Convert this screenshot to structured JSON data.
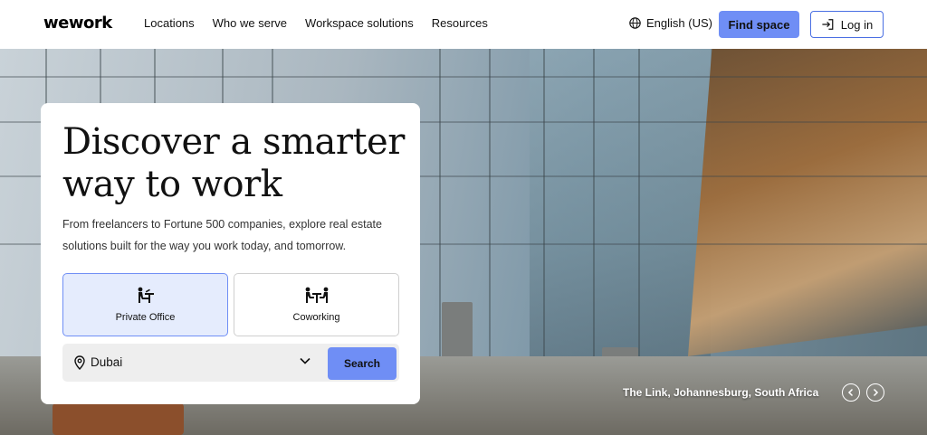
{
  "brand": {
    "logo": "wework"
  },
  "nav": {
    "items": [
      {
        "label": "Locations"
      },
      {
        "label": "Who we serve"
      },
      {
        "label": "Workspace solutions"
      },
      {
        "label": "Resources"
      }
    ],
    "language": "English (US)",
    "find_space": "Find space",
    "login": "Log in"
  },
  "hero": {
    "headline": "Discover a smarter way to work",
    "subtext": "From freelancers to Fortune 500 companies, explore real estate solutions built for the way you work today, and tomorrow.",
    "options": [
      {
        "label": "Private Office",
        "icon": "desk-person-icon",
        "selected": true
      },
      {
        "label": "Coworking",
        "icon": "coworking-icon",
        "selected": false
      }
    ],
    "location": {
      "value": "Dubai",
      "icon": "location-pin-icon"
    },
    "search_label": "Search",
    "caption": "The Link, Johannesburg, South Africa"
  },
  "colors": {
    "accent": "#6f8ef5",
    "selected_bg": "#e5ecfd",
    "login_border": "#4a6fe3"
  }
}
